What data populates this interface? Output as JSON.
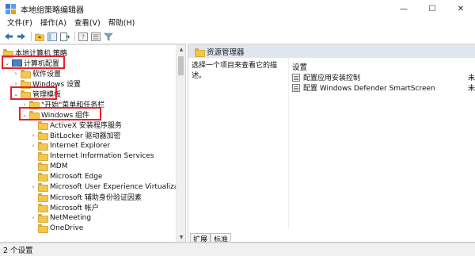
{
  "window": {
    "title": "本地组策略编辑器",
    "controls": [
      "—",
      "☐",
      "✕"
    ]
  },
  "menu": [
    "文件(F)",
    "操作(A)",
    "查看(V)",
    "帮助(H)"
  ],
  "toolbar": {
    "icons": [
      "back-arrow-icon",
      "forward-arrow-icon",
      "up-folder-icon",
      "show-tree-icon",
      "export-list-icon",
      "help-icon",
      "properties-icon",
      "filter-icon"
    ]
  },
  "tree": {
    "root": "本地计算机 策略",
    "computer_config": "计算机配置",
    "software_settings": "软件设置",
    "windows_settings": "Windows 设置",
    "admin_templates": "管理模板",
    "start_menu": "\"开始\"菜单和任务栏",
    "windows_components": "Windows 组件",
    "children": [
      "ActiveX 安装程序服务",
      "BitLocker 驱动器加密",
      "Internet Explorer",
      "Internet Information Services",
      "MDM",
      "Microsoft Edge",
      "Microsoft User Experience Virtualization",
      "Microsoft 辅助身份验证因素",
      "Microsoft 帐户",
      "NetMeeting",
      "OneDrive"
    ]
  },
  "right_pane": {
    "header": "资源管理器",
    "description": "选择一个项目来查看它的描述。",
    "column_header": "设置",
    "settings": [
      {
        "label": "配置应用安装控制",
        "trailing": "未"
      },
      {
        "label": "配置 Windows Defender SmartScreen",
        "trailing": "未"
      }
    ]
  },
  "tabs": [
    "扩展",
    "标准"
  ],
  "status": {
    "text": "2 个设置"
  },
  "colors": {
    "highlight_box": "#e8202a",
    "pane_header_bg": "#dfe6ef",
    "folder": "#f3c64d"
  }
}
